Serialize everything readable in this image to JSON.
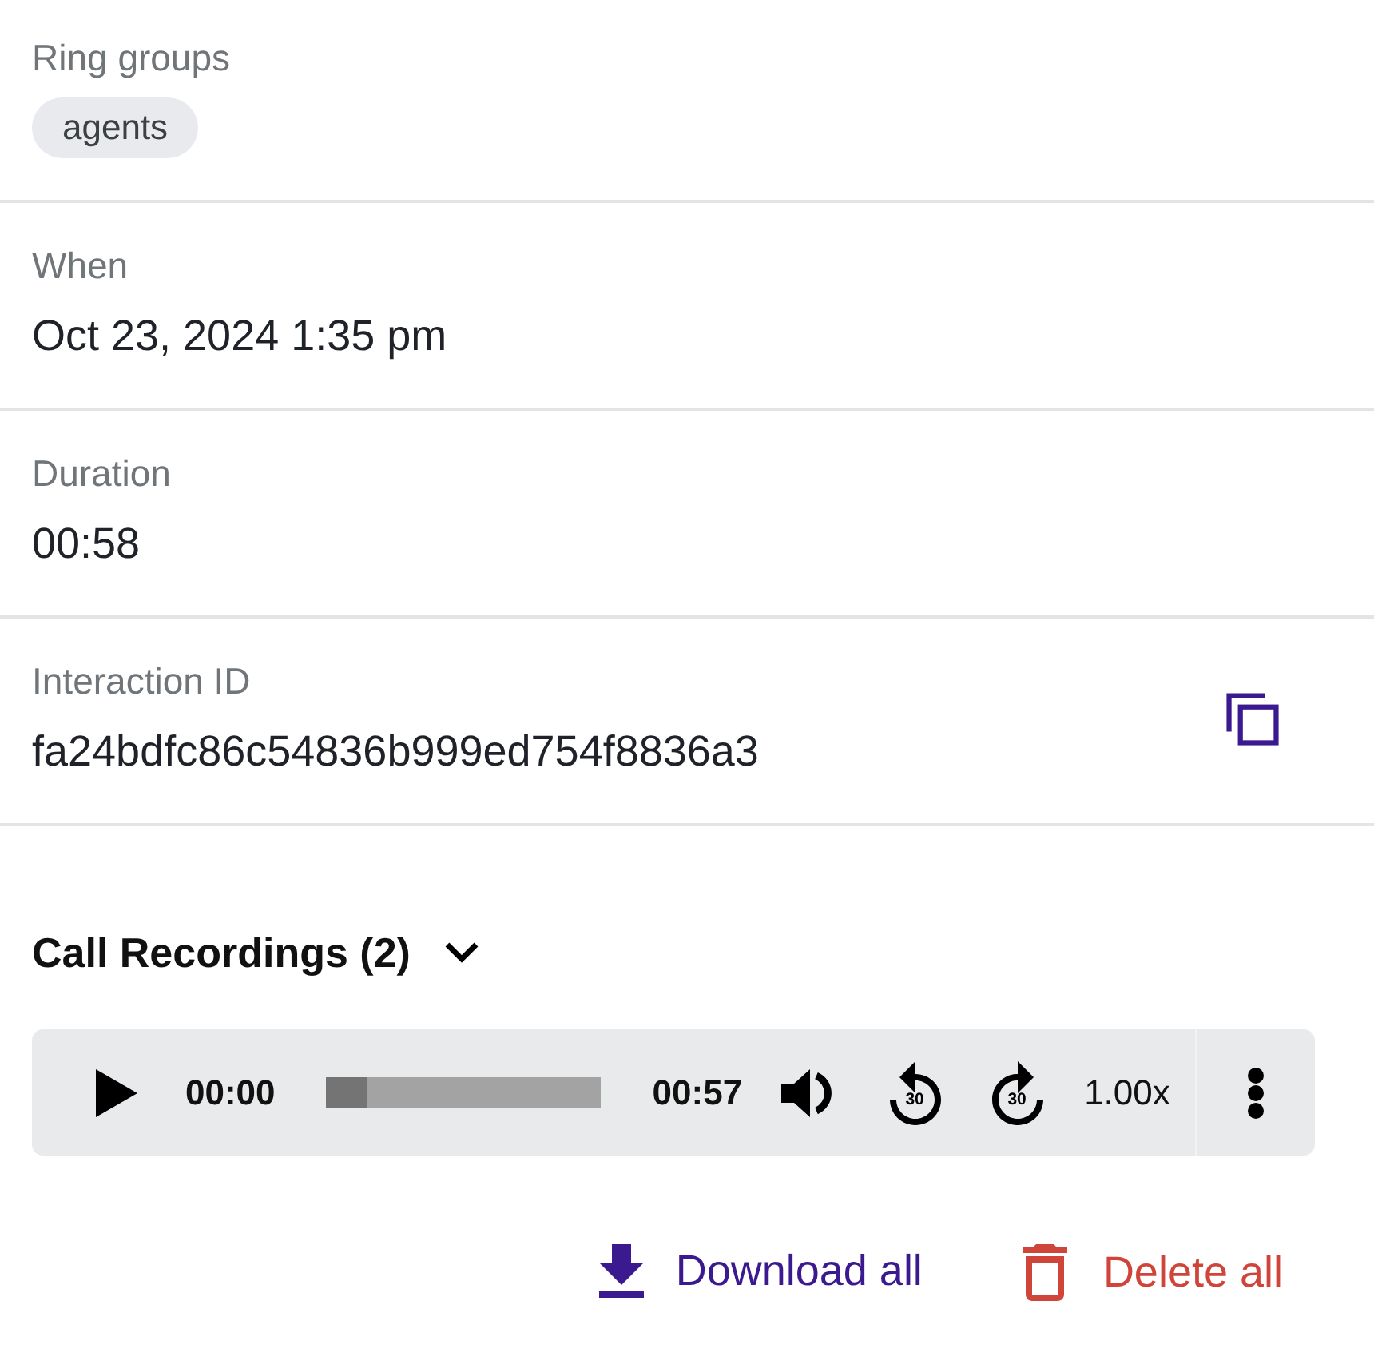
{
  "fields": [
    {
      "kind": "chips",
      "label": "Ring groups",
      "chips": [
        "agents"
      ]
    },
    {
      "kind": "text",
      "label": "When",
      "value": "Oct 23, 2024 1:35 pm"
    },
    {
      "kind": "text",
      "label": "Duration",
      "value": "00:58"
    },
    {
      "kind": "copyable",
      "label": "Interaction ID",
      "value": "fa24bdfc86c54836b999ed754f8836a3"
    }
  ],
  "recordings": {
    "title": "Call Recordings (2)",
    "expanded": true,
    "player": {
      "current_time": "00:00",
      "level": 0.15,
      "total_time": "00:57",
      "skip_back": "30",
      "skip_forward": "30",
      "speed": "1.00x"
    }
  },
  "actions": [
    {
      "kind": "download",
      "label": "Download all"
    },
    {
      "kind": "delete",
      "label": "Delete all"
    }
  ]
}
